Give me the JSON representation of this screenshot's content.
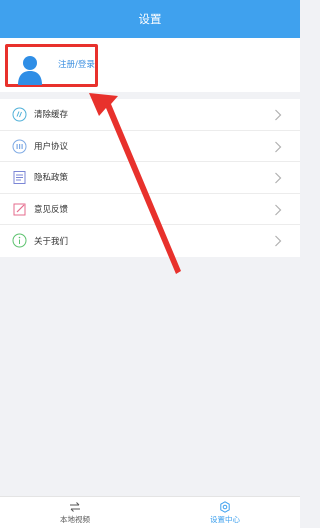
{
  "header": {
    "title": "设置"
  },
  "profile": {
    "label": "注册/登录"
  },
  "menu": {
    "items": [
      {
        "label": "清除缓存",
        "icon": "clear-cache-icon"
      },
      {
        "label": "用户协议",
        "icon": "user-agreement-icon"
      },
      {
        "label": "隐私政策",
        "icon": "privacy-policy-icon"
      },
      {
        "label": "意见反馈",
        "icon": "feedback-icon"
      },
      {
        "label": "关于我们",
        "icon": "about-us-icon"
      }
    ]
  },
  "tabs": [
    {
      "label": "本地视频",
      "icon": "swap-arrows-icon",
      "active": false
    },
    {
      "label": "设置中心",
      "icon": "gear-icon",
      "active": true
    }
  ],
  "colors": {
    "accent": "#3fa1ee",
    "highlight": "#e8312c"
  }
}
